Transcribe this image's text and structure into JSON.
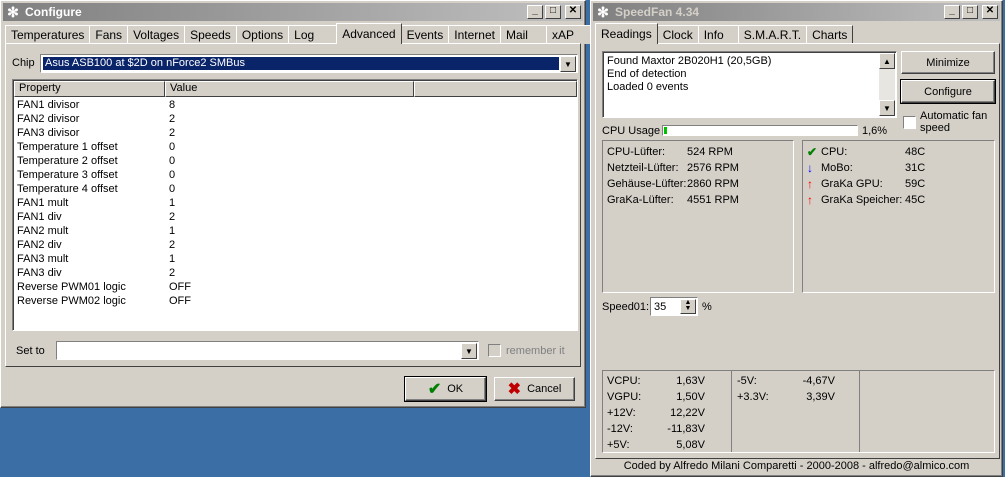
{
  "configure": {
    "title": "Configure",
    "tabs": [
      "Temperatures",
      "Fans",
      "Voltages",
      "Speeds",
      "Options",
      "Log",
      "Advanced",
      "Events",
      "Internet",
      "Mail",
      "xAP"
    ],
    "selected_tab": "Advanced",
    "chip_label": "Chip",
    "chip_value": "Asus ASB100 at $2D on nForce2 SMBus",
    "columns": [
      "Property",
      "Value"
    ],
    "properties": [
      {
        "name": "FAN1 divisor",
        "value": "8"
      },
      {
        "name": "FAN2 divisor",
        "value": "2"
      },
      {
        "name": "FAN3 divisor",
        "value": "2"
      },
      {
        "name": "Temperature 1 offset",
        "value": "0"
      },
      {
        "name": "Temperature 2 offset",
        "value": "0"
      },
      {
        "name": "Temperature 3 offset",
        "value": "0"
      },
      {
        "name": "Temperature 4 offset",
        "value": "0"
      },
      {
        "name": "FAN1 mult",
        "value": "1"
      },
      {
        "name": "FAN1 div",
        "value": "2"
      },
      {
        "name": "FAN2 mult",
        "value": "1"
      },
      {
        "name": "FAN2 div",
        "value": "2"
      },
      {
        "name": "FAN3 mult",
        "value": "1"
      },
      {
        "name": "FAN3 div",
        "value": "2"
      },
      {
        "name": "Reverse PWM01 logic",
        "value": "OFF"
      },
      {
        "name": "Reverse PWM02 logic",
        "value": "OFF"
      }
    ],
    "set_to_label": "Set to",
    "set_to_value": "",
    "remember_label": "remember it",
    "ok_label": "OK",
    "cancel_label": "Cancel"
  },
  "speedfan": {
    "title": "SpeedFan 4.34",
    "tabs": [
      "Readings",
      "Clock",
      "Info",
      "S.M.A.R.T.",
      "Charts"
    ],
    "selected_tab": "Readings",
    "log_lines": [
      "Found Maxtor 2B020H1 (20,5GB)",
      "End of detection",
      "Loaded 0 events"
    ],
    "minimize_label": "Minimize",
    "configure_label": "Configure",
    "auto_fan_label": "Automatic fan speed",
    "cpu_usage_label": "CPU Usage",
    "cpu_usage_text": "1,6%",
    "cpu_usage_fraction": 0.016,
    "fans": [
      {
        "name": "CPU-Lüfter:",
        "value": "524 RPM"
      },
      {
        "name": "Netzteil-Lüfter:",
        "value": "2576 RPM"
      },
      {
        "name": "Gehäuse-Lüfter:",
        "value": "2860 RPM"
      },
      {
        "name": "GraKa-Lüfter:",
        "value": "4551 RPM"
      }
    ],
    "temps": [
      {
        "icon": "check-icon",
        "name": "CPU:",
        "value": "48C"
      },
      {
        "icon": "arrow-down-icon",
        "name": "MoBo:",
        "value": "31C"
      },
      {
        "icon": "arrow-up-icon",
        "name": "GraKa GPU:",
        "value": "59C"
      },
      {
        "icon": "arrow-up-icon",
        "name": "GraKa Speicher:",
        "value": "45C"
      }
    ],
    "speed_label": "Speed01:",
    "speed_value": "35",
    "speed_unit": "%",
    "voltages_left": [
      {
        "name": "VCPU:",
        "value": "1,63V"
      },
      {
        "name": "VGPU:",
        "value": "1,50V"
      },
      {
        "name": "+12V:",
        "value": "12,22V"
      },
      {
        "name": "-12V:",
        "value": "-11,83V"
      },
      {
        "name": "+5V:",
        "value": "5,08V"
      }
    ],
    "voltages_right": [
      {
        "name": "-5V:",
        "value": "-4,67V"
      },
      {
        "name": "+3.3V:",
        "value": "3,39V"
      }
    ],
    "footer": "Coded by Alfredo Milani Comparetti - 2000-2008 - alfredo@almico.com",
    "colors": {
      "check": "#008000",
      "arrow_down": "#0000ff",
      "arrow_up": "#ff0000",
      "cpu_bar": "#00c000"
    }
  }
}
